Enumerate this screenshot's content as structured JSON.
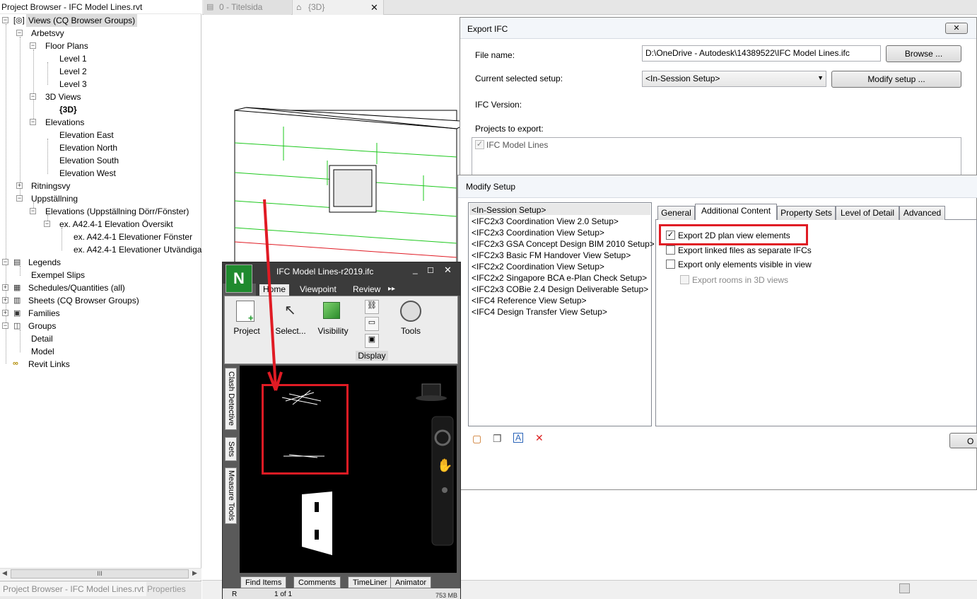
{
  "project_browser": {
    "title": "Project Browser - IFC Model Lines.rvt",
    "tree": [
      {
        "label": "Views (CQ Browser Groups)",
        "selected": true
      },
      {
        "label": "Arbetsvy"
      },
      {
        "label": "Floor Plans"
      },
      {
        "label": "Level 1"
      },
      {
        "label": "Level 2"
      },
      {
        "label": "Level 3"
      },
      {
        "label": "3D Views"
      },
      {
        "label": "{3D}",
        "bold": true
      },
      {
        "label": "Elevations"
      },
      {
        "label": "Elevation East"
      },
      {
        "label": "Elevation North"
      },
      {
        "label": "Elevation South"
      },
      {
        "label": "Elevation West"
      },
      {
        "label": "Ritningsvy"
      },
      {
        "label": "Uppställning"
      },
      {
        "label": "Elevations (Uppställning Dörr/Fönster)"
      },
      {
        "label": "ex. A42.4-1 Elevation Översikt"
      },
      {
        "label": "ex. A42.4-1 Elevationer Fönster"
      },
      {
        "label": "ex. A42.4-1 Elevationer Utvändiga"
      },
      {
        "label": "Legends"
      },
      {
        "label": "Exempel Slips"
      },
      {
        "label": "Schedules/Quantities (all)"
      },
      {
        "label": "Sheets (CQ Browser Groups)"
      },
      {
        "label": "Families"
      },
      {
        "label": "Groups"
      },
      {
        "label": "Detail"
      },
      {
        "label": "Model"
      },
      {
        "label": "Revit Links"
      }
    ],
    "scroll_glyph": "III",
    "bottom_tabs": [
      "Project Browser - IFC Model Lines.rvt",
      "Properties"
    ]
  },
  "view_tabs": [
    {
      "label": "0 - Titelsida",
      "icon": "sheet-icon"
    },
    {
      "label": "{3D}",
      "icon": "3d-view-icon"
    }
  ],
  "view_tab_close": "✕",
  "export_ifc": {
    "title": "Export IFC",
    "close": "✕",
    "file_name_label": "File name:",
    "file_name_value": "D:\\OneDrive - Autodesk\\14389522\\IFC Model Lines.ifc",
    "browse_label": "Browse ...",
    "setup_label": "Current selected setup:",
    "setup_value": "<In-Session Setup>",
    "modify_label": "Modify setup ...",
    "version_label": "IFC Version:",
    "projects_label": "Projects to export:",
    "project_item": "IFC Model Lines",
    "project_checked": true
  },
  "modify_setup": {
    "title": "Modify Setup",
    "setups": [
      "<In-Session Setup>",
      "<IFC2x3 Coordination View 2.0 Setup>",
      "<IFC2x3 Coordination View Setup>",
      "<IFC2x3 GSA Concept Design BIM 2010 Setup>",
      "<IFC2x3 Basic FM Handover View Setup>",
      "<IFC2x2 Coordination View Setup>",
      "<IFC2x2 Singapore BCA e-Plan Check Setup>",
      "<IFC2x3 COBie 2.4 Design Deliverable Setup>",
      "<IFC4 Reference View Setup>",
      "<IFC4 Design Transfer View Setup>"
    ],
    "tabs": [
      "General",
      "Additional Content",
      "Property Sets",
      "Level of Detail",
      "Advanced"
    ],
    "active_tab": "Additional Content",
    "options": [
      {
        "label": "Export 2D plan view elements",
        "checked": true,
        "enabled": true
      },
      {
        "label": "Export linked files as separate IFCs",
        "checked": false,
        "enabled": true
      },
      {
        "label": "Export only elements visible in view",
        "checked": false,
        "enabled": true
      },
      {
        "label": "Export rooms in 3D views",
        "checked": false,
        "enabled": false
      }
    ],
    "ok_partial": "O"
  },
  "navisworks": {
    "title": "IFC Model Lines-r2019.ifc",
    "app_letter": "N",
    "menu": [
      "Home",
      "Viewpoint",
      "Review"
    ],
    "ribbon": {
      "project": "Project",
      "select": "Select...",
      "visibility": "Visibility",
      "display": "Display",
      "tools": "Tools"
    },
    "side_tabs": [
      "Clash Detective",
      "Sets",
      "Measure Tools"
    ],
    "bottom_tabs": [
      "Find Items",
      "Comments",
      "TimeLiner",
      "Animator"
    ],
    "status": {
      "page": "1 of 1",
      "memory": "753 MB",
      "r": "R"
    }
  },
  "colors": {
    "highlight_red": "#e01b24",
    "model_line_green": "#1ec81e",
    "navis_dark": "#3b3b3b"
  }
}
